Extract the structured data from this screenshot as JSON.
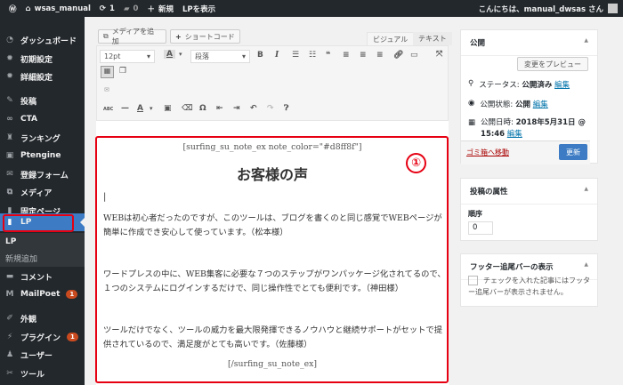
{
  "adminbar": {
    "site": "wsas_manual",
    "updates": "1",
    "comments": "0",
    "new": "新規",
    "view": "LPを表示",
    "greeting": "こんにちは、manual_dwsas さん"
  },
  "sidebar": {
    "items": [
      {
        "label": "ダッシュボード",
        "icon": "dashboard-icon"
      },
      {
        "label": "初期設定",
        "icon": "gear-icon"
      },
      {
        "label": "詳細設定",
        "icon": "gear-icon"
      },
      {
        "label": "投稿",
        "icon": "pin-icon"
      },
      {
        "label": "CTA",
        "icon": "link-icon"
      },
      {
        "label": "ランキング",
        "icon": "ranking-icon"
      },
      {
        "label": "Ptengine",
        "icon": "ptengine-icon"
      },
      {
        "label": "登録フォーム",
        "icon": "mail-icon"
      },
      {
        "label": "メディア",
        "icon": "media-icon"
      },
      {
        "label": "固定ページ",
        "icon": "page-icon"
      },
      {
        "label": "LP",
        "icon": "page-icon"
      },
      {
        "label": "コメント",
        "icon": "comment-icon"
      },
      {
        "label": "MailPoet",
        "icon": "mailpoet-icon",
        "badge": "1"
      },
      {
        "label": "外観",
        "icon": "brush-icon"
      },
      {
        "label": "プラグイン",
        "icon": "plugin-icon",
        "badge": "1"
      },
      {
        "label": "ユーザー",
        "icon": "user-icon"
      },
      {
        "label": "ツール",
        "icon": "wrench-icon"
      }
    ],
    "submenu": [
      "LP",
      "新規追加"
    ]
  },
  "editor": {
    "add_media": "メディアを追加",
    "shortcode": "ショートコード",
    "tab_visual": "ビジュアル",
    "tab_text": "テキスト",
    "font_size": "12pt",
    "format": "段落",
    "text_color": "A",
    "content": {
      "open": "[surfing_su_note_ex note_color=\"#d8ff8f\"]",
      "heading": "お客様の声",
      "paragraphs": [
        "WEBは初心者だったのですが、このツールは、ブログを書くのと同じ感覚でWEBページが簡単に作成でき安心して使っています。（松本様）",
        "ワードプレスの中に、WEB集客に必要な７つのステップがワンパッケージ化されてるので、１つのシステムにログインするだけで、同じ操作性でとても便利です。（神田様）",
        "ツールだけでなく、ツールの威力を最大限発揮できるノウハウと継続サポートがセットで提供されているので、満足度がとても高いです。（佐藤様）"
      ],
      "close": "[/surfing_su_note_ex]"
    },
    "annotation": "①"
  },
  "publish": {
    "title": "公開",
    "preview": "変更をプレビュー",
    "status_label": "ステータス:",
    "status": "公開済み",
    "visibility_label": "公開状態:",
    "visibility": "公開",
    "date_label": "公開日時:",
    "date": "2018年5月31日 @",
    "time": "15:46",
    "edit": "編集",
    "trash": "ゴミ箱へ移動",
    "update": "更新"
  },
  "attributes": {
    "title": "投稿の属性",
    "order_label": "順序",
    "order": "0"
  },
  "footer_bar": {
    "title": "フッター追尾バーの表示",
    "checkbox_label": "チェックを入れた記事にはフッター追尾バーが表示されません。"
  },
  "colors": {
    "accent": "#3d7cc4",
    "highlight": "#e60012",
    "adminbar": "#23282d"
  }
}
